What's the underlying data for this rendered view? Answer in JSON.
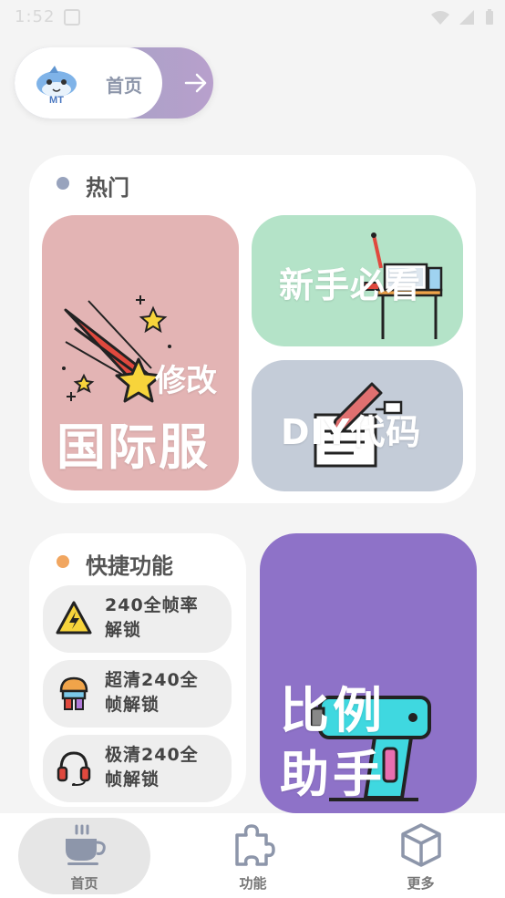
{
  "status_bar": {
    "time": "1:52"
  },
  "home_pill": {
    "logo_text": "MT",
    "label": "首页"
  },
  "hot": {
    "title": "热门",
    "tiles": {
      "modify_small": "修改",
      "modify_big": "国际服",
      "newbie": "新手必看",
      "diy": "DIY代码"
    }
  },
  "quick": {
    "title": "快捷功能",
    "items": [
      {
        "line1": "240全帧率",
        "line2": "解锁",
        "icon": "warning-bolt-icon"
      },
      {
        "line1": "超清240全",
        "line2": "帧解锁",
        "icon": "paint-bucket-icon"
      },
      {
        "line1": "极清240全",
        "line2": "帧解锁",
        "icon": "headset-icon"
      }
    ]
  },
  "promo": {
    "line1": "比例",
    "line2": "助手"
  },
  "bottom_nav": [
    {
      "label": "首页",
      "icon": "coffee-cup-icon",
      "active": true
    },
    {
      "label": "功能",
      "icon": "puzzle-icon",
      "active": false
    },
    {
      "label": "更多",
      "icon": "cube-icon",
      "active": false
    }
  ],
  "colors": {
    "dot_hot": "#98a3bd",
    "dot_quick": "#f1a660",
    "tile_red": "#e3b4b4",
    "tile_green": "#b4e3c8",
    "tile_blue": "#c4ccd8",
    "tile_purple": "#8e72c8"
  }
}
